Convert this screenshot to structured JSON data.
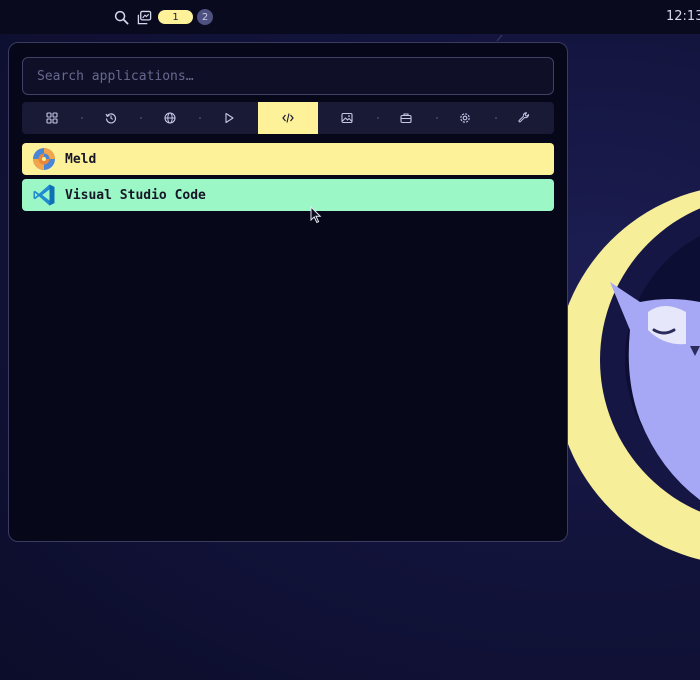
{
  "topbar": {
    "icons": [
      "search-icon",
      "window-overview-icon"
    ],
    "workspaces": [
      {
        "label": "1",
        "active": true
      },
      {
        "label": "2",
        "active": false
      }
    ],
    "clock": "12:13"
  },
  "launcher": {
    "search": {
      "placeholder": "Search applications…",
      "value": ""
    },
    "categories": [
      {
        "icon": "grid-icon",
        "active": false
      },
      {
        "icon": "history-icon",
        "active": false
      },
      {
        "icon": "globe-icon",
        "active": false
      },
      {
        "icon": "play-icon",
        "active": false
      },
      {
        "icon": "code-icon",
        "active": true
      },
      {
        "icon": "image-icon",
        "active": false
      },
      {
        "icon": "briefcase-icon",
        "active": false
      },
      {
        "icon": "gear-icon",
        "active": false
      },
      {
        "icon": "wrench-icon",
        "active": false
      }
    ],
    "apps": [
      {
        "name": "Meld",
        "icon": "meld-icon",
        "color": "#fdf29a"
      },
      {
        "name": "Visual Studio Code",
        "icon": "vscode-icon",
        "color": "#9cf7c6"
      }
    ]
  },
  "colors": {
    "accent": "#fdf29a",
    "highlight_green": "#9cf7c6",
    "panel_bg": "#07071a",
    "owl": "#a6a8f5",
    "moon": "#f7ee9a"
  }
}
